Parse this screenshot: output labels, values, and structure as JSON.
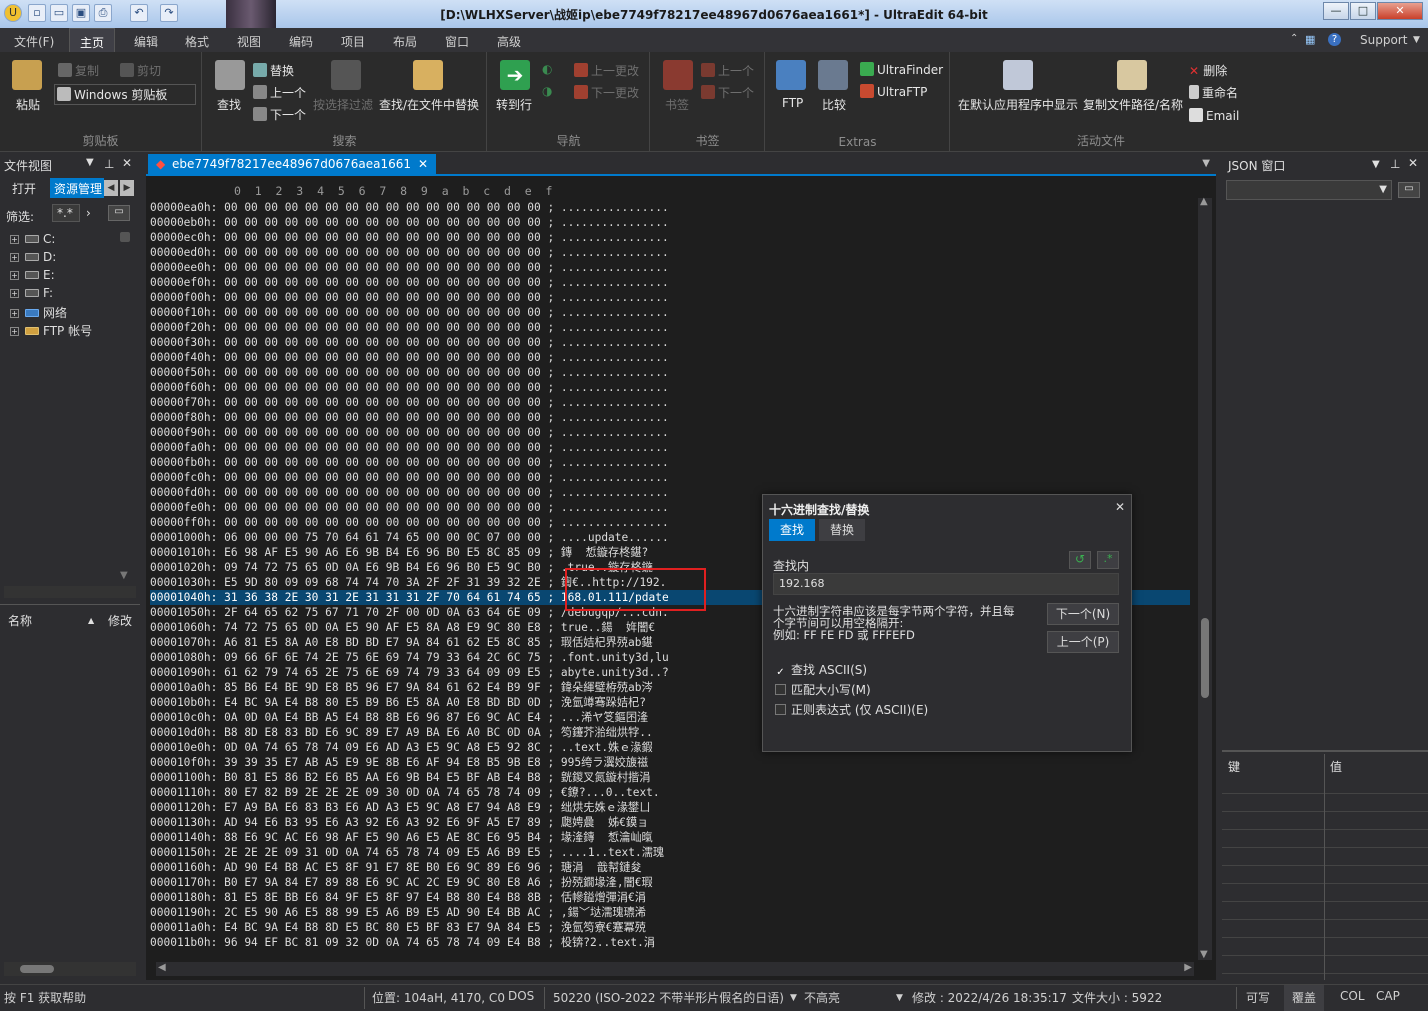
{
  "titlebar": {
    "title": "[D:\\WLHXServer\\战姬ip\\ebe7749f78217ee48967d0676aea1661*] - UltraEdit 64-bit",
    "min": "—",
    "max": "□",
    "close": "✕"
  },
  "menu": {
    "items": [
      "文件(F)",
      "主页",
      "编辑",
      "格式",
      "视图",
      "编码",
      "项目",
      "布局",
      "窗口",
      "高级"
    ],
    "support": "Support"
  },
  "ribbon": {
    "clipboard": {
      "paste": "粘贴",
      "copy": "复制",
      "cut": "剪切",
      "windows_clipboard": "Windows 剪贴板",
      "label": "剪贴板"
    },
    "search": {
      "find": "查找",
      "replace": "替换",
      "prev": "上一个",
      "next": "下一个",
      "filter": "按选择过滤",
      "find_in_files": "查找/在文件中替换",
      "label": "搜索"
    },
    "nav": {
      "goto": "转到行",
      "prev_change": "上一更改",
      "next_change": "下一更改",
      "label": "导航"
    },
    "bookmarks": {
      "bookmark": "书签",
      "prev": "上一个",
      "next": "下一个",
      "label": "书签"
    },
    "extras": {
      "ftp": "FTP",
      "compare": "比较",
      "ultrafinder": "UltraFinder",
      "ultraftp": "UltraFTP",
      "label": "Extras"
    },
    "active_file": {
      "show_default": "在默认应用程序中显示",
      "copy_path": "复制文件路径/名称",
      "delete": "删除",
      "rename": "重命名",
      "email": "Email",
      "label": "活动文件"
    }
  },
  "left_panel": {
    "title": "文件视图",
    "tab_open": "打开",
    "tab_explorer": "资源管理",
    "filter_label": "筛选:",
    "filter_value": "*.*",
    "tree": [
      "C:",
      "D:",
      "E:",
      "F:",
      "网络",
      "FTP 帐号"
    ],
    "col_name": "名称",
    "col_modified": "修改"
  },
  "editor": {
    "tab_name": "ebe7749f78217ee48967d0676aea1661",
    "ruler": "0  1  2  3  4  5  6  7  8  9  a  b  c  d  e  f",
    "rows": [
      [
        "00000ea0h:",
        "00 00 00 00 00 00 00 00 00 00 00 00 00 00 00 00",
        "; ................"
      ],
      [
        "00000eb0h:",
        "00 00 00 00 00 00 00 00 00 00 00 00 00 00 00 00",
        "; ................"
      ],
      [
        "00000ec0h:",
        "00 00 00 00 00 00 00 00 00 00 00 00 00 00 00 00",
        "; ................"
      ],
      [
        "00000ed0h:",
        "00 00 00 00 00 00 00 00 00 00 00 00 00 00 00 00",
        "; ................"
      ],
      [
        "00000ee0h:",
        "00 00 00 00 00 00 00 00 00 00 00 00 00 00 00 00",
        "; ................"
      ],
      [
        "00000ef0h:",
        "00 00 00 00 00 00 00 00 00 00 00 00 00 00 00 00",
        "; ................"
      ],
      [
        "00000f00h:",
        "00 00 00 00 00 00 00 00 00 00 00 00 00 00 00 00",
        "; ................"
      ],
      [
        "00000f10h:",
        "00 00 00 00 00 00 00 00 00 00 00 00 00 00 00 00",
        "; ................"
      ],
      [
        "00000f20h:",
        "00 00 00 00 00 00 00 00 00 00 00 00 00 00 00 00",
        "; ................"
      ],
      [
        "00000f30h:",
        "00 00 00 00 00 00 00 00 00 00 00 00 00 00 00 00",
        "; ................"
      ],
      [
        "00000f40h:",
        "00 00 00 00 00 00 00 00 00 00 00 00 00 00 00 00",
        "; ................"
      ],
      [
        "00000f50h:",
        "00 00 00 00 00 00 00 00 00 00 00 00 00 00 00 00",
        "; ................"
      ],
      [
        "00000f60h:",
        "00 00 00 00 00 00 00 00 00 00 00 00 00 00 00 00",
        "; ................"
      ],
      [
        "00000f70h:",
        "00 00 00 00 00 00 00 00 00 00 00 00 00 00 00 00",
        "; ................"
      ],
      [
        "00000f80h:",
        "00 00 00 00 00 00 00 00 00 00 00 00 00 00 00 00",
        "; ................"
      ],
      [
        "00000f90h:",
        "00 00 00 00 00 00 00 00 00 00 00 00 00 00 00 00",
        "; ................"
      ],
      [
        "00000fa0h:",
        "00 00 00 00 00 00 00 00 00 00 00 00 00 00 00 00",
        "; ................"
      ],
      [
        "00000fb0h:",
        "00 00 00 00 00 00 00 00 00 00 00 00 00 00 00 00",
        "; ................"
      ],
      [
        "00000fc0h:",
        "00 00 00 00 00 00 00 00 00 00 00 00 00 00 00 00",
        "; ................"
      ],
      [
        "00000fd0h:",
        "00 00 00 00 00 00 00 00 00 00 00 00 00 00 00 00",
        "; ................"
      ],
      [
        "00000fe0h:",
        "00 00 00 00 00 00 00 00 00 00 00 00 00 00 00 00",
        "; ................"
      ],
      [
        "00000ff0h:",
        "00 00 00 00 00 00 00 00 00 00 00 00 00 00 00 00",
        "; ................"
      ],
      [
        "00001000h:",
        "06 00 00 00 75 70 64 61 74 65 00 00 0C 07 00 00",
        "; ....update......"
      ],
      [
        "00001010h:",
        "E6 98 AF E5 90 A6 E6 9B B4 E6 96 B0 E5 8C 85 09",
        "; 鏄  惁鏇存柊鍖?"
      ],
      [
        "00001020h:",
        "09 74 72 75 65 0D 0A E6 9B B4 E6 96 B0 E5 9C B0",
        "; .true..鏇存柊鍦"
      ],
      [
        "00001030h:",
        "E5 9D 80 09 09 68 74 74 70 3A 2F 2F 31 39 32 2E",
        "; 鍧€..http://192."
      ],
      [
        "00001040h:",
        "31 36 38 2E 30 31 2E 31 31 31 2F 70 64 61 74 65",
        "; 168.01.111/pdate"
      ],
      [
        "00001050h:",
        "2F 64 65 62 75 67 71 70 2F 00 0D 0A 63 64 6E 09",
        "; /debugqp/...cdn."
      ],
      [
        "00001060h:",
        "74 72 75 65 0D 0A E5 90 AF E5 8A A8 E9 9C 80 E8",
        "; true..鍚  姩闇€"
      ],
      [
        "00001070h:",
        "A6 81 E5 8A A0 E8 BD BD E7 9A 84 61 62 E5 8C 85",
        "; 瑕佸姞杞界殑ab鍖"
      ],
      [
        "00001080h:",
        "09 66 6F 6E 74 2E 75 6E 69 74 79 33 64 2C 6C 75",
        "; .font.unity3d,lu"
      ],
      [
        "00001090h:",
        "61 62 79 74 65 2E 75 6E 69 74 79 33 64 09 09 E5",
        "; abyte.unity3d..?"
      ],
      [
        "000010a0h:",
        "85 B6 E4 BE 9D E8 B5 96 E7 9A 84 61 62 E4 B9 9F",
        "; 鍏朵緷璧栫殑ab涔"
      ],
      [
        "000010b0h:",
        "E4 BC 9A E4 B8 80 E5 B9 B6 E5 8A A0 E8 BD BD 0D",
        "; 浼氫竴骞跺姞杞?"
      ],
      [
        "000010c0h:",
        "0A 0D 0A E4 BB A5 E4 B8 8B E6 96 87 E6 9C AC E4",
        "; ...浠ヤ笅鏂囨湰"
      ],
      [
        "000010d0h:",
        "B8 8D E8 83 BD E6 9C 89 E7 A9 BA E6 A0 BC 0D 0A",
        "; 笉鑳芥湁绌烘牸.."
      ],
      [
        "000010e0h:",
        "0D 0A 74 65 78 74 09 E6 AD A3 E5 9C A8 E5 92 8C",
        "; ..text.姝ｅ湪鍜"
      ],
      [
        "000010f0h:",
        "39 39 35 E7 AB A5 E9 9E 8B E6 AF 94 E8 B5 9B E8",
        "; 995绔ラ瀷姣旇禌"
      ],
      [
        "00001100h:",
        "B0 81 E5 86 B2 E6 B5 AA E6 9B B4 E5 BF AB E4 B8",
        "; 皝鍐叉氮鏇村揩涓"
      ],
      [
        "00001110h:",
        "80 E7 82 B9 2E 2E 2E 09 30 0D 0A 74 65 78 74 09",
        "; €鐐?...0..text."
      ],
      [
        "00001120h:",
        "E7 A9 BA E6 83 B3 E6 AD A3 E5 9C A8 E7 94 A8 E9",
        "; 绌烘兂姝ｅ湪鐢ㄩ"
      ],
      [
        "00001130h:",
        "AD 94 E6 B3 95 E6 A3 92 E6 A3 92 E6 9F A5 E7 89",
        "; 瓟娉曟  姊€鏌ョ"
      ],
      [
        "00001140h:",
        "88 E6 9C AC E6 98 AF E5 90 A6 E5 AE 8C E6 95 B4",
        "; 堟湰鏄  惁瀹屾暣"
      ],
      [
        "00001150h:",
        "2E 2E 2E 09 31 0D 0A 74 65 78 74 09 E5 A6 B9 E5",
        "; ....1..text.濡瑰"
      ],
      [
        "00001160h:",
        "AD 90 E4 B8 AC E5 8F 91 E7 8E B0 E6 9C 89 E6 96",
        "; 瑭涓  戠幇鏈夋"
      ],
      [
        "00001170h:",
        "B0 E7 9A 84 E7 89 88 E6 9C AC 2C E9 9C 80 E8 A6",
        "; 扮殑鐗堟湰,闇€瑕"
      ],
      [
        "00001180h:",
        "81 E5 8E BB E6 84 9F E5 8F 97 E4 B8 80 E4 B8 8B",
        "; 佸幓鎰熷彈涓€涓"
      ],
      [
        "00001190h:",
        "2C E5 90 A6 E5 88 99 E5 A6 B9 E5 AD 90 E4 BB AC",
        "; ,鍚﹀垯濡瑰瓙浠"
      ],
      [
        "000011a0h:",
        "E4 BC 9A E4 B8 8D E5 BC 80 E5 BF 83 E7 9A 84 E5",
        "; 浼氫笉寮€蹇冪殑"
      ],
      [
        "000011b0h:",
        "96 94 EF BC 81 09 32 0D 0A 74 65 78 74 09 E4 B8",
        "; 杸锛?2..text.涓"
      ]
    ],
    "selected_row": 26
  },
  "dialog": {
    "title": "十六进制查找/替换",
    "tab_find": "查找",
    "tab_replace": "替换",
    "find_label": "查找内",
    "find_value": "192.168",
    "hint1": "十六进制字符串应该是每字节两个字符，并且每",
    "hint2": "个字节间可以用空格隔开:",
    "hint3": "例如: FF FE FD 或 FFFEFD",
    "next": "下一个(N)",
    "prev": "上一个(P)",
    "opt_ascii": "查找 ASCII(S)",
    "opt_case": "匹配大小写(M)",
    "opt_regex": "正则表达式 (仅 ASCII)(E)"
  },
  "right_panel": {
    "title": "JSON 窗口",
    "col_key": "键",
    "col_value": "值"
  },
  "status": {
    "help": "按 F1 获取帮助",
    "position": "位置: 104aH, 4170, C0",
    "eol": "DOS",
    "encoding": "50220 (ISO-2022 不带半形片假名的日语)",
    "highlight": "不高亮",
    "modified": "修改 :  2022/4/26 18:35:17",
    "filesize": "文件大小 :  5922",
    "writable": "可写",
    "overwrite": "覆盖",
    "col": "COL",
    "cap": "CAP"
  },
  "colors": {
    "accent": "#007acc",
    "bg": "#1e1e1e",
    "panel": "#2d2d30",
    "highlight_box": "#e02020"
  }
}
